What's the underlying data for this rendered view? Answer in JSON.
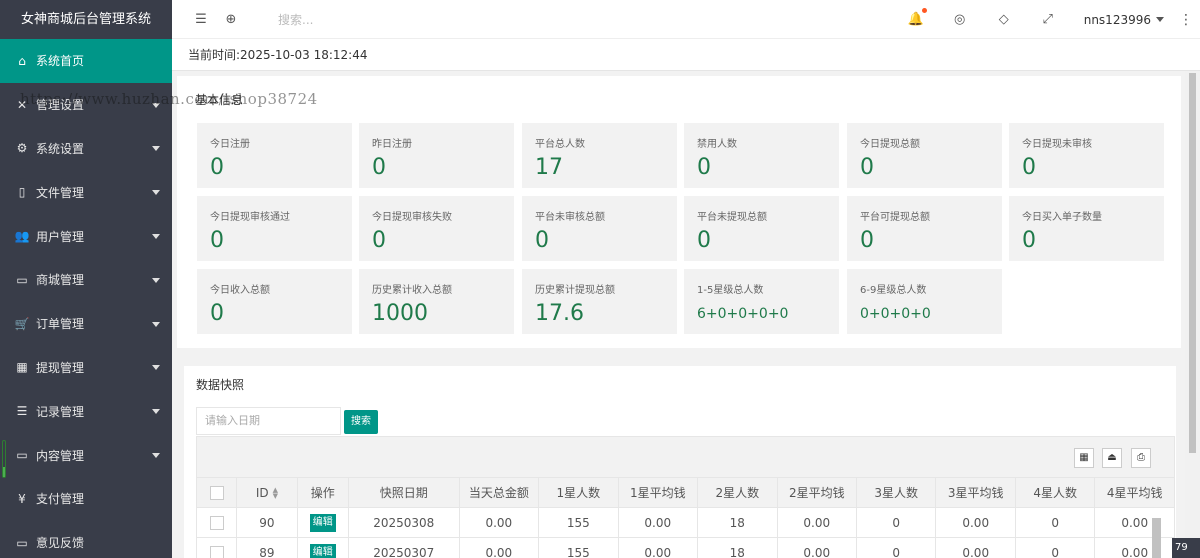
{
  "sidebar": {
    "title": "女神商城后台管理系统",
    "items": [
      {
        "label": "系统首页",
        "icon": "home-icon",
        "glyph": "⌂",
        "active": true,
        "arrow": false
      },
      {
        "label": "管理设置",
        "icon": "tools-icon",
        "glyph": "✕",
        "active": false,
        "arrow": true
      },
      {
        "label": "系统设置",
        "icon": "gear-icon",
        "glyph": "⚙",
        "active": false,
        "arrow": true
      },
      {
        "label": "文件管理",
        "icon": "file-icon",
        "glyph": "▯",
        "active": false,
        "arrow": true
      },
      {
        "label": "用户管理",
        "icon": "users-icon",
        "glyph": "👥",
        "active": false,
        "arrow": true
      },
      {
        "label": "商城管理",
        "icon": "shop-icon",
        "glyph": "▭",
        "active": false,
        "arrow": true
      },
      {
        "label": "订单管理",
        "icon": "cart-icon",
        "glyph": "🛒",
        "active": false,
        "arrow": true
      },
      {
        "label": "提现管理",
        "icon": "withdraw-icon",
        "glyph": "▦",
        "active": false,
        "arrow": true
      },
      {
        "label": "记录管理",
        "icon": "list-icon",
        "glyph": "☰",
        "active": false,
        "arrow": true
      },
      {
        "label": "内容管理",
        "icon": "content-icon",
        "glyph": "▭",
        "active": false,
        "arrow": true
      },
      {
        "label": "支付管理",
        "icon": "yen-icon",
        "glyph": "¥",
        "active": false,
        "arrow": false
      },
      {
        "label": "意见反馈",
        "icon": "feedback-icon",
        "glyph": "▭",
        "active": false,
        "arrow": false
      }
    ]
  },
  "header": {
    "search_placeholder": "搜索...",
    "username": "nns123996"
  },
  "current_time": "当前时间:2025-10-03 18:12:44",
  "watermark": "https://www.huzhan.com/ishop38724",
  "basic_info": {
    "title": "基本信息",
    "stats": [
      {
        "label": "今日注册",
        "value": "0"
      },
      {
        "label": "昨日注册",
        "value": "0"
      },
      {
        "label": "平台总人数",
        "value": "17"
      },
      {
        "label": "禁用人数",
        "value": "0"
      },
      {
        "label": "今日提现总额",
        "value": "0"
      },
      {
        "label": "今日提现未审核",
        "value": "0"
      },
      {
        "label": "今日提现审核通过",
        "value": "0"
      },
      {
        "label": "今日提现审核失败",
        "value": "0"
      },
      {
        "label": "平台未审核总额",
        "value": "0"
      },
      {
        "label": "平台未提现总额",
        "value": "0"
      },
      {
        "label": "平台可提现总额",
        "value": "0"
      },
      {
        "label": "今日买入单子数量",
        "value": "0"
      },
      {
        "label": "今日收入总额",
        "value": "0"
      },
      {
        "label": "历史累计收入总额",
        "value": "1000"
      },
      {
        "label": "历史累计提现总额",
        "value": "17.6"
      },
      {
        "label": "1-5星级总人数",
        "value": "6+0+0+0+0"
      },
      {
        "label": "6-9星级总人数",
        "value": "0+0+0+0"
      }
    ]
  },
  "snapshot": {
    "title": "数据快照",
    "date_placeholder": "请输入日期",
    "search_button": "搜索",
    "columns": [
      "ID",
      "操作",
      "快照日期",
      "当天总金额",
      "1星人数",
      "1星平均钱",
      "2星人数",
      "2星平均钱",
      "3星人数",
      "3星平均钱",
      "4星人数",
      "4星平均钱"
    ],
    "edit_label": "编辑",
    "rows": [
      [
        "90",
        "20250308",
        "0.00",
        "155",
        "0.00",
        "18",
        "0.00",
        "0",
        "0.00",
        "0",
        "0.00"
      ],
      [
        "89",
        "20250307",
        "0.00",
        "155",
        "0.00",
        "18",
        "0.00",
        "0",
        "0.00",
        "0",
        "0.00"
      ]
    ]
  },
  "corner_badge": "79"
}
